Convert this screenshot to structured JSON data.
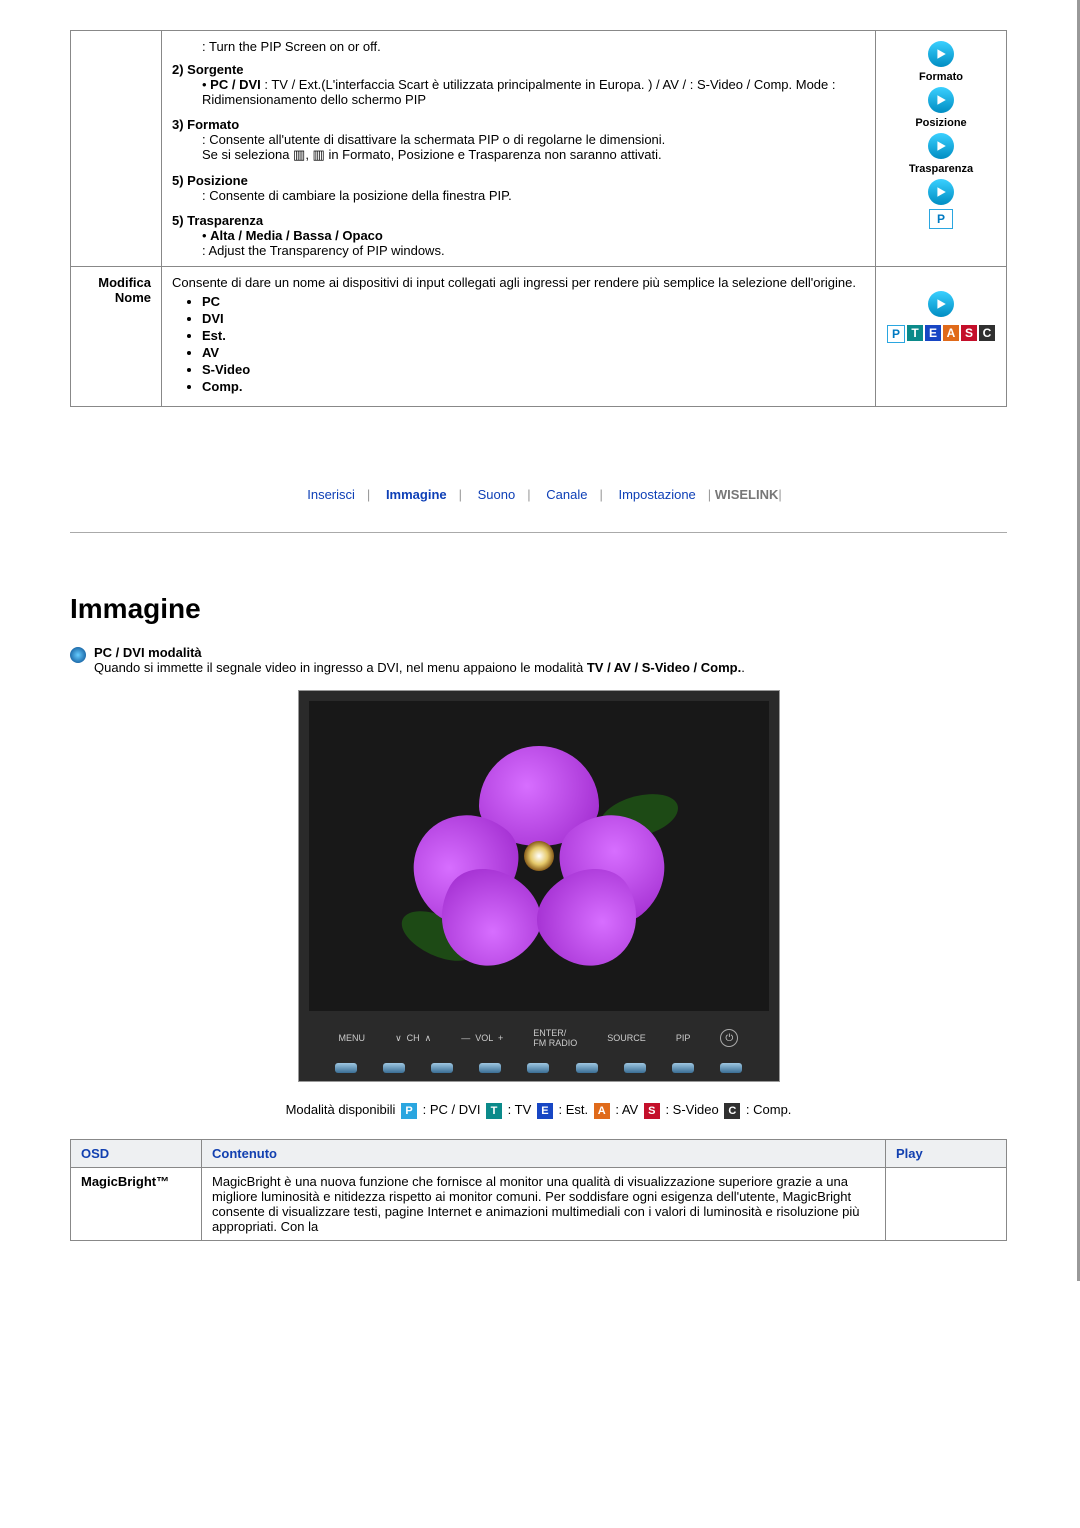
{
  "pip": {
    "turn": ": Turn the PIP Screen on or off.",
    "sorgente_h": "2) Sorgente",
    "sorgente_bullet": "PC / DVI",
    "sorgente_body": " : TV / Ext.(L'interfaccia Scart è utilizzata principalmente in Europa. ) / AV / : S-Video / Comp. Mode : Ridimensionamento dello schermo PIP",
    "formato_h": "3) Formato",
    "formato_body": ": Consente all'utente di disattivare la schermata PIP o di regolarne le dimensioni.\nSe si seleziona ▥, ▥ in Formato, Posizione e Trasparenza non saranno attivati.",
    "posizione_h": "5) Posizione",
    "posizione_body": ": Consente di cambiare la posizione della finestra PIP.",
    "trasp_h": "5) Trasparenza",
    "trasp_bullet": "Alta / Media / Bassa / Opaco",
    "trasp_body": ": Adjust the Transparency of PIP windows.",
    "icons": {
      "formato": "Formato",
      "posizione": "Posizione",
      "trasparenza": "Trasparenza"
    }
  },
  "modnome": {
    "label1": "Modifica",
    "label2": "Nome",
    "body": "Consente di dare un nome ai dispositivi di input collegati agli ingressi per rendere più semplice la selezione dell'origine.",
    "items": [
      "PC",
      "DVI",
      "Est.",
      "AV",
      "S-Video",
      "Comp."
    ],
    "pteasc": [
      "P",
      "T",
      "E",
      "A",
      "S",
      "C"
    ]
  },
  "menu": {
    "inserisci": "Inserisci",
    "immagine": "Immagine",
    "suono": "Suono",
    "canale": "Canale",
    "impostazione": "Impostazione",
    "wiselink": "WISELINK"
  },
  "sec2": {
    "title": "Immagine",
    "mode_h": "PC / DVI modalità",
    "mode_body1": "Quando si immette il segnale video in ingresso a DVI, nel menu appaiono le modalità ",
    "mode_body_bold": "TV / AV / S-Video / Comp.",
    "mode_body2": "."
  },
  "screenbar": [
    "MENU",
    "∨  CH  ∧",
    "—  VOL  +",
    "ENTER/\nFM RADIO",
    "SOURCE",
    "PIP"
  ],
  "modes": {
    "prefix": "Modalità disponibili   ",
    "items": [
      {
        "tag": "P",
        "cls": "t-P",
        "txt": ": PC / DVI"
      },
      {
        "tag": "T",
        "cls": "t-T",
        "txt": ": TV"
      },
      {
        "tag": "E",
        "cls": "t-E",
        "txt": ": Est."
      },
      {
        "tag": "A",
        "cls": "t-A",
        "txt": ": AV"
      },
      {
        "tag": "S",
        "cls": "t-S",
        "txt": ": S-Video"
      },
      {
        "tag": "C",
        "cls": "t-C",
        "txt": ": Comp."
      }
    ]
  },
  "osd": {
    "headers": {
      "osd": "OSD",
      "content": "Contenuto",
      "play": "Play"
    },
    "row1_label": "MagicBright™",
    "row1_body": "MagicBright è una nuova funzione che fornisce al monitor una qualità di visualizzazione superiore grazie a una migliore luminosità e nitidezza rispetto ai monitor comuni. Per soddisfare ogni esigenza dell'utente, MagicBright consente di visualizzare testi, pagine Internet e animazioni multimediali con i valori di luminosità e risoluzione più appropriati. Con la"
  }
}
